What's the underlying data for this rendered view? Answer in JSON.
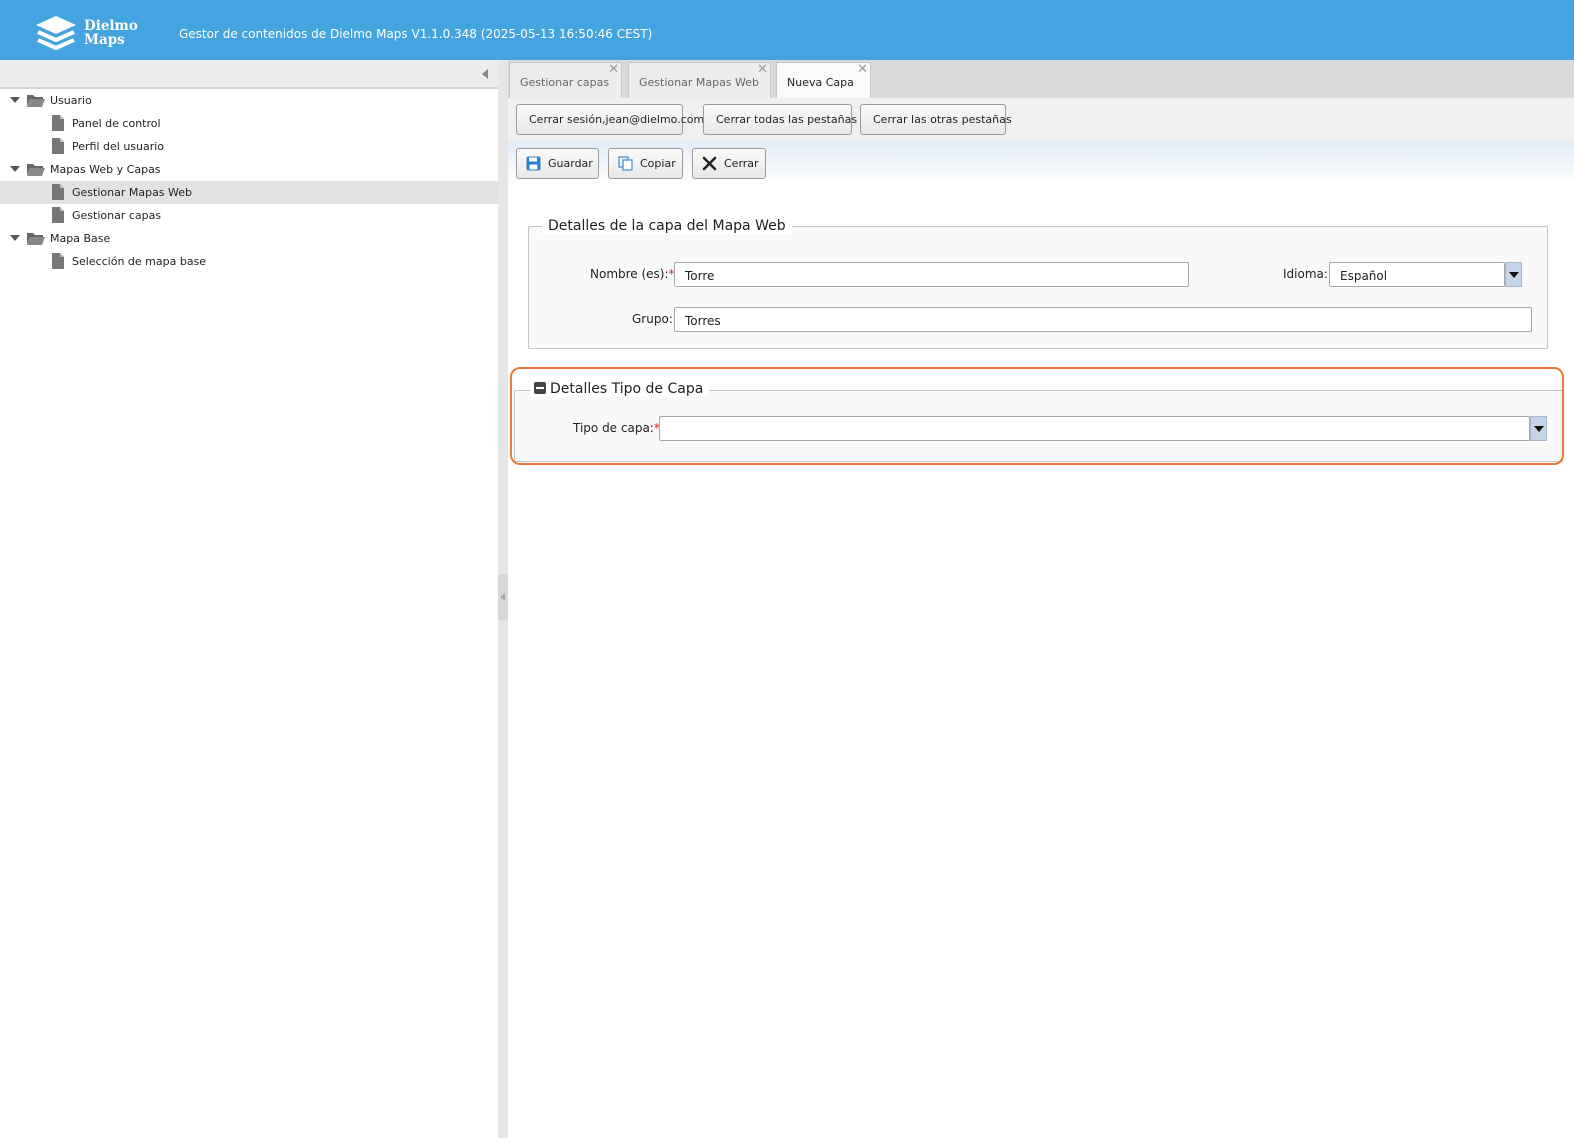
{
  "header": {
    "logo_line1": "Dielmo",
    "logo_line2": "Maps",
    "title": "Gestor de contenidos de Dielmo Maps V1.1.0.348 (2025-05-13 16:50:46 CEST)",
    "background": "#44a4e0"
  },
  "tree": {
    "items": [
      {
        "label": "Usuario",
        "type": "folder",
        "icon": "folder-open-icon"
      },
      {
        "label": "Panel de control",
        "type": "doc",
        "icon": "document-icon"
      },
      {
        "label": "Perfil del usuario",
        "type": "doc",
        "icon": "document-icon"
      },
      {
        "label": "Mapas Web y Capas",
        "type": "folder",
        "icon": "folder-open-icon"
      },
      {
        "label": "Gestionar Mapas Web",
        "type": "doc",
        "icon": "document-icon",
        "selected": true
      },
      {
        "label": "Gestionar capas",
        "type": "doc",
        "icon": "document-icon"
      },
      {
        "label": "Mapa Base",
        "type": "folder",
        "icon": "folder-open-icon"
      },
      {
        "label": "Selección de mapa base",
        "type": "doc",
        "icon": "document-icon"
      }
    ]
  },
  "tabs": [
    {
      "label": "Gestionar capas",
      "active": false
    },
    {
      "label": "Gestionar Mapas Web",
      "active": false
    },
    {
      "label": "Nueva Capa",
      "active": true
    }
  ],
  "session_toolbar": {
    "logout_label": "Cerrar sesión,jean@dielmo.com",
    "close_all_label": "Cerrar todas las pestañas",
    "close_others_label": "Cerrar las otras pestañas"
  },
  "form_toolbar": {
    "save_label": "Guardar",
    "copy_label": "Copiar",
    "close_label": "Cerrar"
  },
  "layer_details": {
    "legend": "Detalles de la capa del Mapa Web",
    "name_label": "Nombre (es):",
    "name_value": "Torre",
    "language_label": "Idioma:",
    "language_value": "Español",
    "group_label": "Grupo:",
    "group_value": "Torres"
  },
  "layer_type_details": {
    "legend": "Detalles Tipo de Capa",
    "type_label": "Tipo de capa:",
    "type_value": "",
    "highlight_color": "#e9773f"
  },
  "required_marker": "*"
}
